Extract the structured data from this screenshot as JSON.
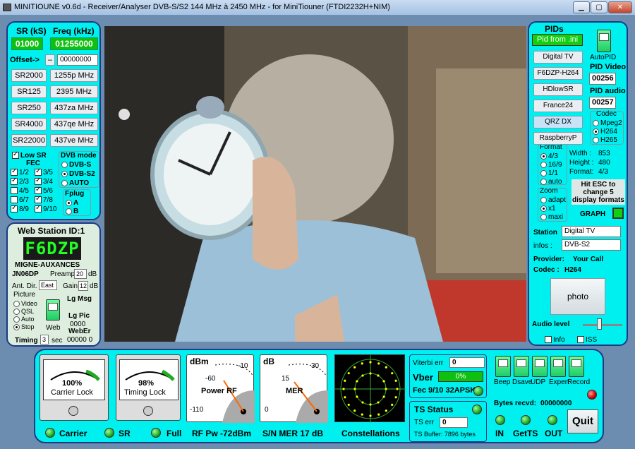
{
  "window": {
    "title": "MINITIOUNE v0.6d - Receiver/Analyser DVB-S/S2 144 MHz à 2450 MHz - for MiniTiouner (FTDI2232H+NIM)"
  },
  "left": {
    "sr_header": "SR (kS)",
    "freq_header": "Freq (kHz)",
    "sr_value": "01000",
    "freq_value": "01255000",
    "offset_label": "Offset->",
    "offset_btn": "–",
    "offset_value": "00000000",
    "sr_buttons": [
      "SR2000",
      "SR125",
      "SR250",
      "SR4000",
      "SR22000"
    ],
    "freq_buttons": [
      "1255p MHz",
      "2395 MHz",
      "437za MHz",
      "437qe MHz",
      "437ve MHz"
    ],
    "low_sr": "Low SR",
    "fec_label": "FEC",
    "fec": [
      {
        "a": "1/2",
        "a_on": true,
        "b": "3/5",
        "b_on": true
      },
      {
        "a": "2/3",
        "a_on": true,
        "b": "3/4",
        "b_on": true
      },
      {
        "a": "4/5",
        "a_on": false,
        "b": "5/6",
        "b_on": true
      },
      {
        "a": "6/7",
        "a_on": false,
        "b": "7/8",
        "b_on": true
      },
      {
        "a": "8/9",
        "a_on": true,
        "b": "9/10",
        "b_on": true
      }
    ],
    "dvb_mode": "DVB mode",
    "dvb_opts": [
      "DVB-S",
      "DVB-S2",
      "AUTO"
    ],
    "fplug": "Fplug",
    "fplug_opts": [
      "A",
      "B"
    ]
  },
  "station": {
    "header": "Web Station ID:1",
    "callsign": "F6DZP",
    "qth": "MIGNE-AUXANCES",
    "locator": "JN06DP",
    "preamp_label": "Preamp",
    "preamp_value": "20",
    "preamp_unit": "dB",
    "antdir_label": "Ant. Dir.",
    "antdir_value": "East",
    "gain_label": "Gain",
    "gain_value": "12",
    "gain_unit": "dB",
    "picture_label": "Picture",
    "picture_opts": [
      "Video",
      "QSL",
      "Auto",
      "Stop"
    ],
    "lg_msg": "Lg Msg",
    "lg_pic": "Lg Pic",
    "lg_pic_value": "0000",
    "web_label": "Web",
    "weber": "WebEr",
    "weber_value": "00000 0",
    "timing_label": "Timing",
    "timing_value": "3",
    "timing_unit": "sec"
  },
  "right": {
    "pids": "PIDs",
    "pid_from": "Pid from .ini",
    "buttons": [
      "Digital TV",
      "F6DZP-H264",
      "HDlowSR",
      "France24",
      "QRZ DX",
      "RaspberryP"
    ],
    "autopid": "AutoPID",
    "pid_video_label": "PID Video",
    "pid_video": "00256",
    "pid_audio_label": "PID audio",
    "pid_audio": "00257",
    "codec_label": "Codec",
    "codec_opts": [
      "Mpeg2",
      "H264",
      "H265"
    ],
    "format_label": "Format",
    "format_opts": [
      "4/3",
      "16/9",
      "1/1",
      "auto"
    ],
    "width_label": "Width :",
    "width": "853",
    "height_label": "Height :",
    "height": "480",
    "format_info_label": "Format:",
    "format_info": "4/3",
    "zoom_label": "Zoom",
    "zoom_opts": [
      "adapt",
      "x1",
      "maxi"
    ],
    "esc_msg": "Hit ESC to change  5 display formats",
    "graph": "GRAPH",
    "station_label": "Station",
    "station_value": "Digital TV",
    "infos_label": "infos :",
    "infos_value": "DVB-S2",
    "provider_label": "Provider:",
    "provider_value": "Your Call",
    "codec_info_label": "Codec :",
    "codec_info_value": "H264",
    "photo": "photo",
    "audio_level": "Audio level",
    "info_cb": "Info",
    "iss_cb": "ISS"
  },
  "bottom": {
    "carrier_pct": "100%",
    "carrier_lock": "Carrier Lock",
    "timing_pct": "98%",
    "timing_lock": "Timing Lock",
    "carrier_led": "Carrier",
    "sr_led": "SR",
    "full_led": "Full",
    "dbm": "dBm",
    "power_rf": "Power RF",
    "rf_scale": [
      "-10",
      "-60",
      "-110"
    ],
    "rf_pw": "RF Pw  -72dBm",
    "db": "dB",
    "mer": "MER",
    "mer_scale": [
      "30",
      "15",
      "0"
    ],
    "sn_mer": "S/N MER   17 dB",
    "constellations": "Constellations",
    "viterbi_label": "Viterbi err",
    "viterbi_value": "0",
    "vber_label": "Vber",
    "vber_value": "0%",
    "fec_info": "Fec 9/10 32APSK",
    "ts_status": "TS Status",
    "ts_err_label": "TS err",
    "ts_err_value": "0",
    "ts_buffer": "TS Buffer: 7896 bytes",
    "switches": [
      "Beep",
      "Dsave",
      "UDP",
      "Expert",
      "Record"
    ],
    "bytes_label": "Bytes recvd:",
    "bytes_value": "00000000",
    "in": "IN",
    "getts": "GetTS",
    "out": "OUT",
    "quit": "Quit"
  },
  "colors": {
    "panel": "#00f0f0",
    "border": "#1c3a86",
    "lcd": "#10c010",
    "led": "#2a2"
  },
  "meters": {
    "carrier_fraction": 1.0,
    "timing_fraction": 0.98,
    "rf_dbm": -72,
    "mer_db": 17
  }
}
